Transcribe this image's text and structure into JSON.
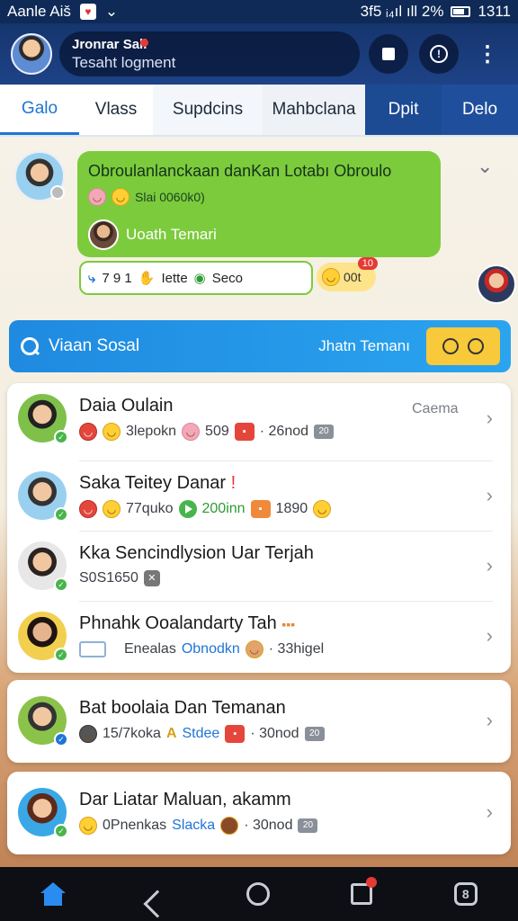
{
  "status_bar": {
    "left_text": "Aanle Aiš",
    "right_text": "3f5 ᵢ₄ıl ıll 2%",
    "time": "1311"
  },
  "header": {
    "name": "Jronrar Sali",
    "subtitle": "Tesaht logment",
    "icons": [
      "stop-icon",
      "info-icon",
      "more-vertical-icon"
    ]
  },
  "tabs": [
    {
      "label": "Galo",
      "active": true
    },
    {
      "label": "Vlass"
    },
    {
      "label": "Supdcins"
    },
    {
      "label": "Mahbclana"
    },
    {
      "label": "Dpit"
    },
    {
      "label": "Delo"
    }
  ],
  "message": {
    "title": "Obroulanlanckaan danKan Lotabı Obroulo",
    "sub": "Slai 0060k0)",
    "author": "Uoath Temari",
    "reactions": {
      "count_a": "7 9 1",
      "text_a": "Iette",
      "text_b": "Seco"
    },
    "count_badge": "10",
    "count_text": "00t"
  },
  "search": {
    "label": "Viaan Sosal",
    "right_label": "Jhatn Temanı"
  },
  "list": [
    {
      "title": "Daia Oulain",
      "tag": "Caema",
      "meta": [
        "3lepokn",
        "509",
        "· 26nod"
      ],
      "badge": "20"
    },
    {
      "title": "Saka Teitey Danar",
      "meta": [
        "77quko",
        "200inn",
        "1890"
      ]
    },
    {
      "title": "Kka Sencindlysion Uar Terjah",
      "meta": [
        "S0S1650"
      ]
    },
    {
      "title": "Phnahk Ooalandarty Tah",
      "meta": [
        "Enealas",
        "Obnodkn",
        "· 33higel"
      ]
    },
    {
      "title": "Bat boolaia Dan Temanan",
      "meta": [
        "15/7koka",
        "Stdee",
        "· 30nod"
      ],
      "badge": "20"
    },
    {
      "title": "Dar Liatar Maluan, akamm",
      "meta": [
        "0Pnenkas",
        "Slacka",
        "· 30nod"
      ],
      "badge": "20"
    }
  ],
  "colors": {
    "header_bg": "#16356e",
    "accent_blue": "#1f74d8",
    "bubble_green": "#7ccb3c",
    "search_blue": "#1f8ae0",
    "search_yellow": "#f7c93b"
  },
  "navbar": {
    "icons": [
      "home-icon",
      "back-icon",
      "home-circle-icon",
      "recents-icon",
      "app-icon"
    ]
  }
}
